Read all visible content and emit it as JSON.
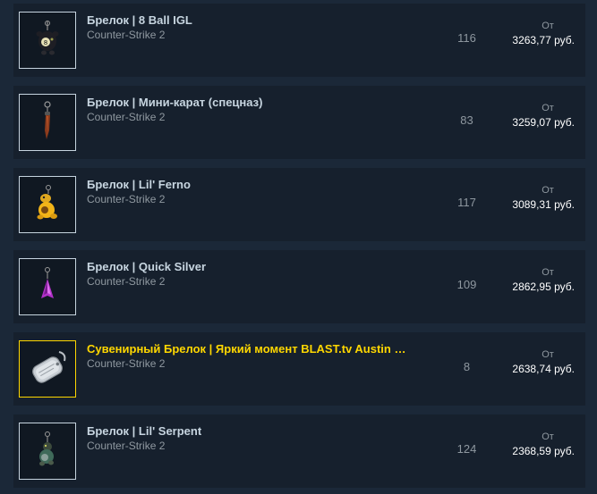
{
  "items": [
    {
      "name": "Брелок | 8 Ball IGL",
      "game": "Counter-Strike 2",
      "quantity": "116",
      "price_prefix": "От",
      "price": "3263,77 руб.",
      "icon": "keychain-8ball-icon",
      "souvenir": false
    },
    {
      "name": "Брелок | Мини-карат (спецназ)",
      "game": "Counter-Strike 2",
      "quantity": "83",
      "price_prefix": "От",
      "price": "3259,07 руб.",
      "icon": "keychain-knife-icon",
      "souvenir": false
    },
    {
      "name": "Брелок | Lil' Ferno",
      "game": "Counter-Strike 2",
      "quantity": "117",
      "price_prefix": "От",
      "price": "3089,31 руб.",
      "icon": "keychain-ferno-icon",
      "souvenir": false
    },
    {
      "name": "Брелок | Quick Silver",
      "game": "Counter-Strike 2",
      "quantity": "109",
      "price_prefix": "От",
      "price": "2862,95 руб.",
      "icon": "keychain-quicksilver-icon",
      "souvenir": false
    },
    {
      "name": "Сувенирный Брелок | Яркий момент BLAST.tv Austin …",
      "game": "Counter-Strike 2",
      "quantity": "8",
      "price_prefix": "От",
      "price": "2638,74 руб.",
      "icon": "keychain-dogtag-icon",
      "souvenir": true
    },
    {
      "name": "Брелок | Lil' Serpent",
      "game": "Counter-Strike 2",
      "quantity": "124",
      "price_prefix": "От",
      "price": "2368,59 руб.",
      "icon": "keychain-serpent-icon",
      "souvenir": false
    }
  ],
  "colors": {
    "page_background": "#1b2838",
    "row_background": "#16202d",
    "name_text": "#c7d5e0",
    "souvenir_text": "#ffd700",
    "muted_text": "#8f98a0",
    "price_text": "#ffffff"
  }
}
